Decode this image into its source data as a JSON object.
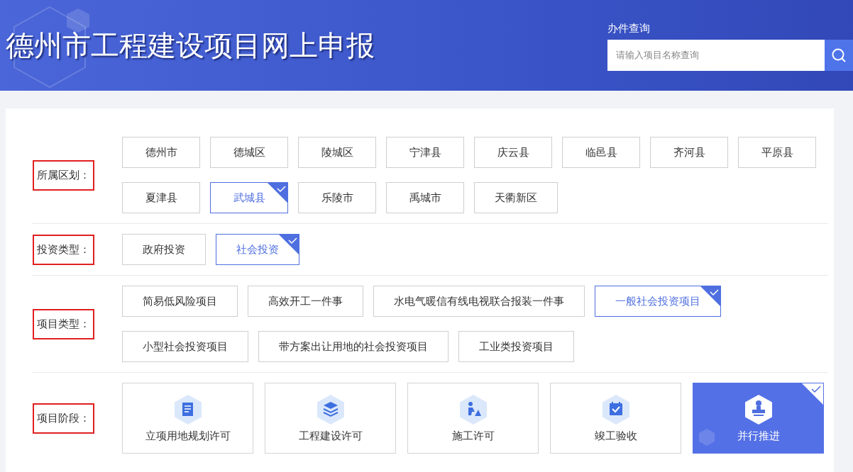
{
  "header": {
    "title": "德州市工程建设项目网上申报",
    "search": {
      "label": "办件查询",
      "placeholder": "请输入项目名称查询"
    }
  },
  "filters": [
    {
      "label": "所属区划：",
      "options": [
        {
          "text": "德州市",
          "selected": false
        },
        {
          "text": "德城区",
          "selected": false
        },
        {
          "text": "陵城区",
          "selected": false
        },
        {
          "text": "宁津县",
          "selected": false
        },
        {
          "text": "庆云县",
          "selected": false
        },
        {
          "text": "临邑县",
          "selected": false
        },
        {
          "text": "齐河县",
          "selected": false
        },
        {
          "text": "平原县",
          "selected": false
        },
        {
          "text": "夏津县",
          "selected": false
        },
        {
          "text": "武城县",
          "selected": true
        },
        {
          "text": "乐陵市",
          "selected": false
        },
        {
          "text": "禹城市",
          "selected": false
        },
        {
          "text": "天衢新区",
          "selected": false
        }
      ]
    },
    {
      "label": "投资类型：",
      "options": [
        {
          "text": "政府投资",
          "selected": false
        },
        {
          "text": "社会投资",
          "selected": true
        }
      ]
    },
    {
      "label": "项目类型：",
      "options": [
        {
          "text": "简易低风险项目",
          "selected": false
        },
        {
          "text": "高效开工一件事",
          "selected": false
        },
        {
          "text": "水电气暖信有线电视联合报装一件事",
          "selected": false
        },
        {
          "text": "一般社会投资项目",
          "selected": true
        },
        {
          "text": "小型社会投资项目",
          "selected": false
        },
        {
          "text": "带方案出让用地的社会投资项目",
          "selected": false
        },
        {
          "text": "工业类投资项目",
          "selected": false
        }
      ]
    }
  ],
  "stages": {
    "label": "项目阶段：",
    "items": [
      {
        "text": "立项用地规划许可",
        "kind": "document",
        "selected": false
      },
      {
        "text": "工程建设许可",
        "kind": "layers",
        "selected": false
      },
      {
        "text": "施工许可",
        "kind": "worker",
        "selected": false
      },
      {
        "text": "竣工验收",
        "kind": "calendar",
        "selected": false
      },
      {
        "text": "并行推进",
        "kind": "stamp",
        "selected": true
      }
    ]
  }
}
